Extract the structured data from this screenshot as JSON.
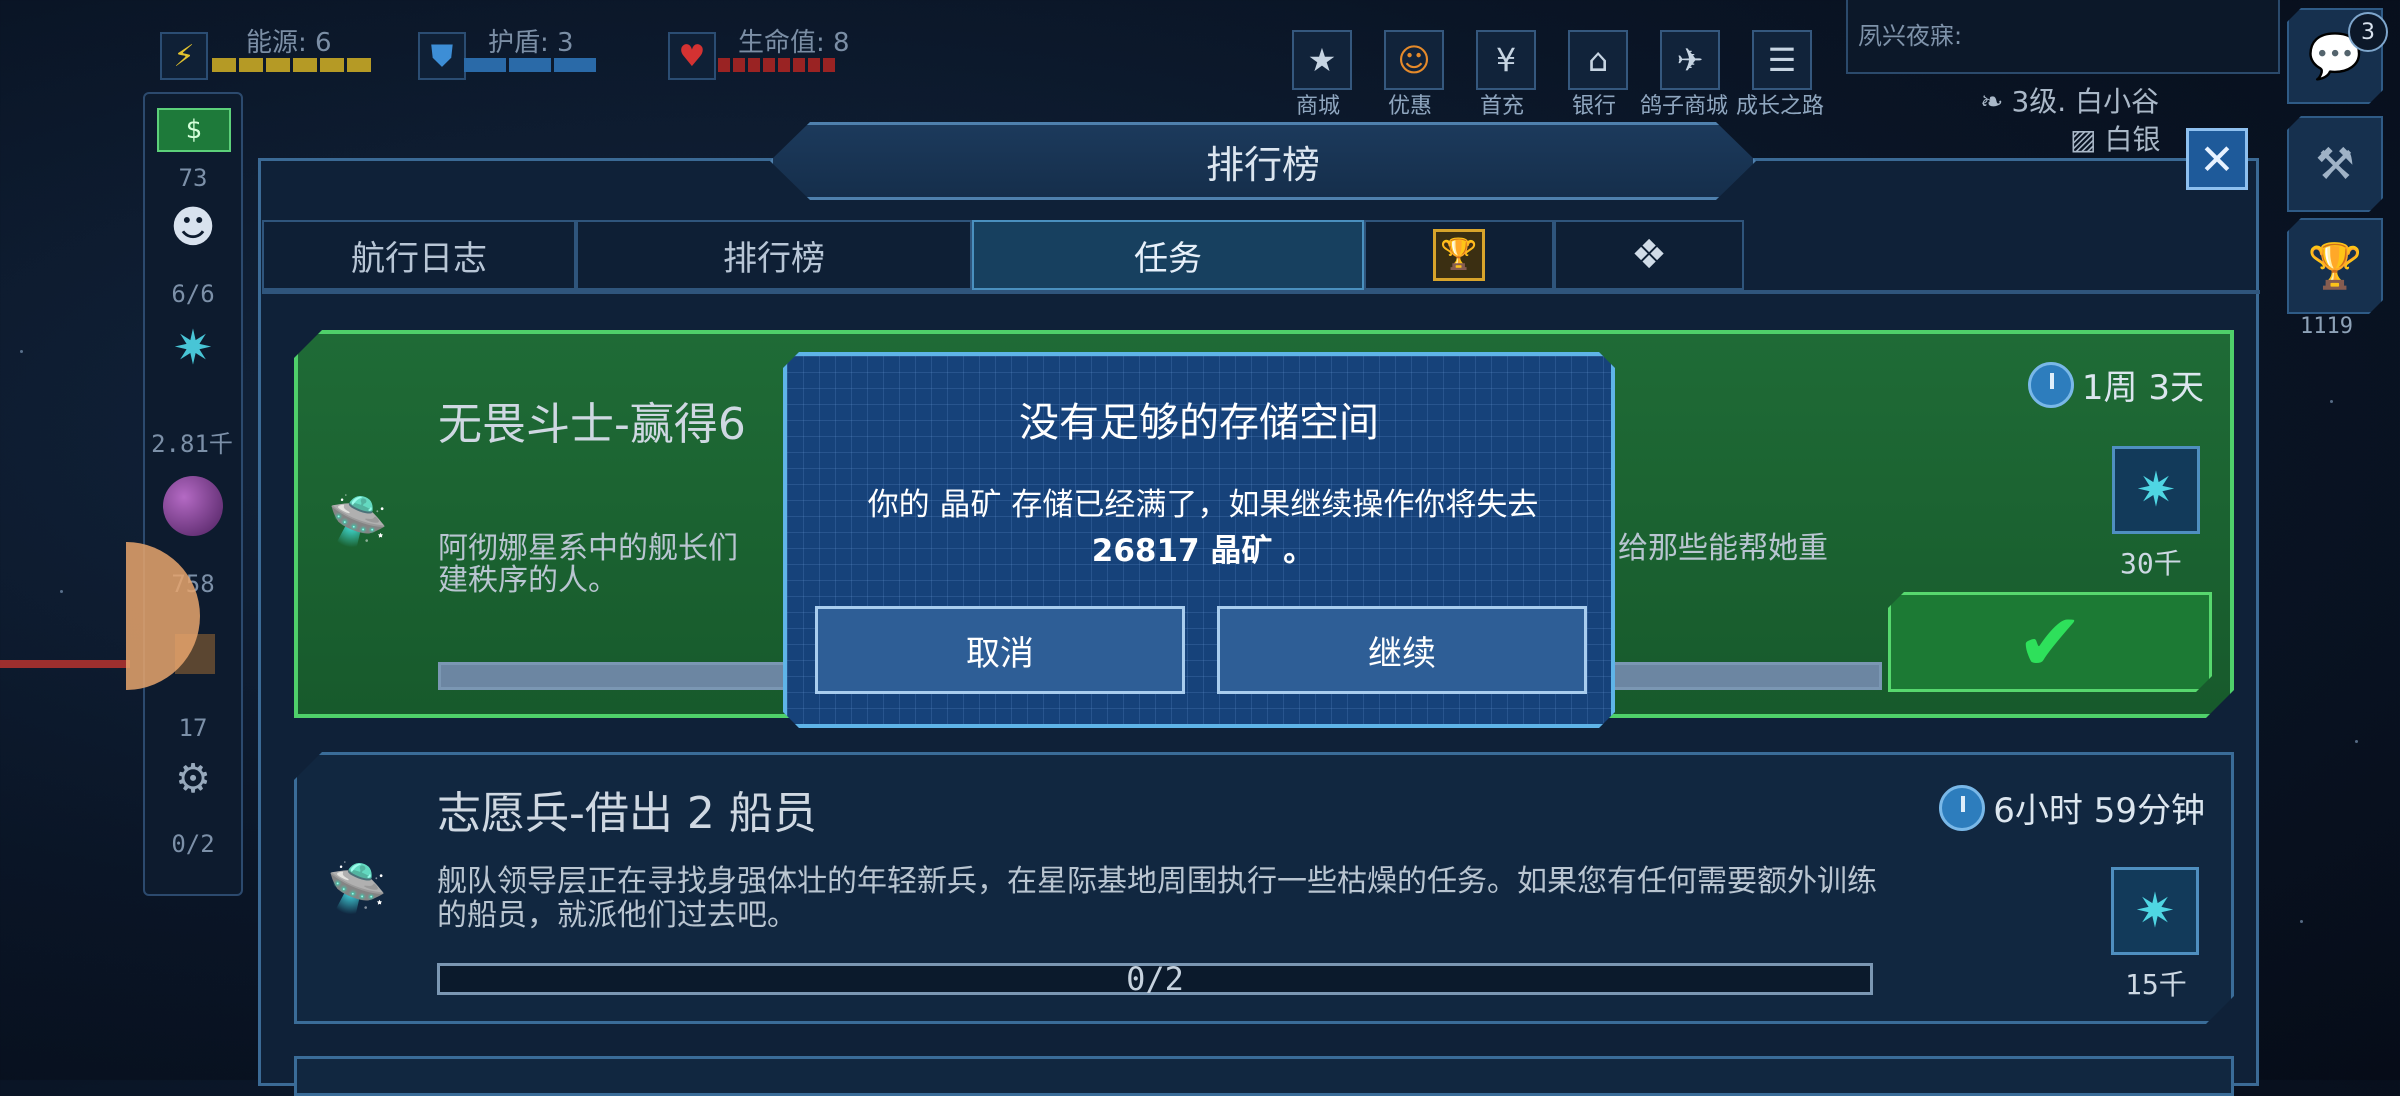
{
  "status": {
    "energy_label": "能源: 6",
    "shield_label": "护盾: 3",
    "life_label": "生命值: 8"
  },
  "top_menu": [
    {
      "label": "商城",
      "icon": "star-icon"
    },
    {
      "label": "优惠",
      "icon": "smile-icon"
    },
    {
      "label": "首充",
      "icon": "yen-icon"
    },
    {
      "label": "银行",
      "icon": "bank-icon"
    },
    {
      "label": "鸽子商城",
      "icon": "dove-icon"
    },
    {
      "label": "成长之路",
      "icon": "list-icon"
    }
  ],
  "chat": {
    "preview": "夙兴夜寐:",
    "badge": "3",
    "player_line1": "3级. 白小谷",
    "player_line2": "白银"
  },
  "sidebar": {
    "money": "73",
    "crew": "6/6",
    "crystals": "2.81千",
    "orb": "758",
    "parts": "17",
    "drones": "0/2"
  },
  "right_panel": {
    "trophy_count": "1119"
  },
  "panel": {
    "title": "排行榜",
    "tabs": [
      "航行日志",
      "排行榜",
      "任务",
      "",
      ""
    ]
  },
  "quests": [
    {
      "title": "无畏斗士-赢得6",
      "description_left": "阿彻娜星系中的舰长们",
      "description_right": "给那些能帮她重",
      "description_line2": "建秩序的人。",
      "timer": "1周 3天",
      "reward": "30千"
    },
    {
      "title": "志愿兵-借出 2 船员",
      "description": "舰队领导层正在寻找身强体壮的年轻新兵，在星际基地周围执行一些枯燥的任务。如果您有任何需要额外训练的船员，就派他们过去吧。",
      "timer": "6小时 59分钟",
      "progress_text": "0/2",
      "progress": 0,
      "reward": "15千"
    }
  ],
  "modal": {
    "title": "没有足够的存储空间",
    "message_line1": "你的 晶矿 存储已经满了，如果继续操作你将失去",
    "message_line2": "26817 晶矿 。",
    "cancel": "取消",
    "continue": "继续"
  },
  "colors": {
    "accent": "#3b6a95",
    "completed_card": "#1f6b36",
    "modal_bg": "#16427a"
  }
}
